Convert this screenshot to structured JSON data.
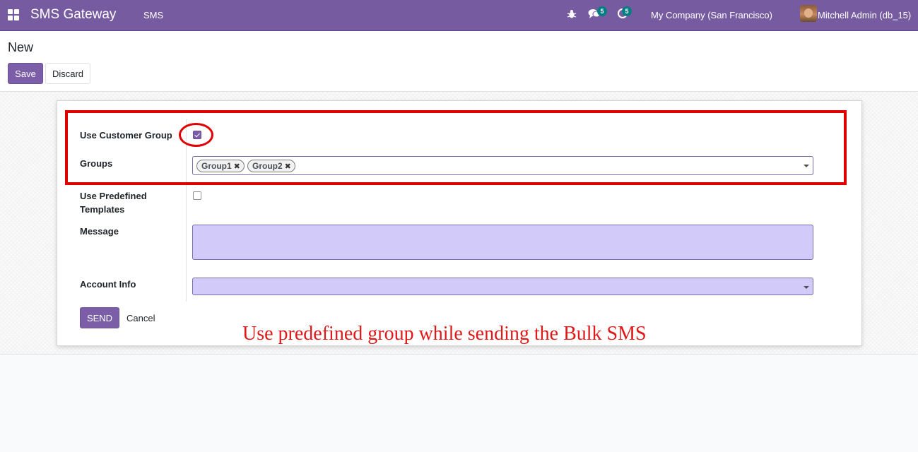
{
  "navbar": {
    "app_title": "SMS Gateway",
    "menu_item": "SMS",
    "chat_badge": "5",
    "activity_badge": "5",
    "company": "My Company (San Francisco)",
    "user": "Mitchell Admin (db_15)",
    "icons": [
      "apps-icon",
      "bug-icon",
      "chat-icon",
      "clock-icon",
      "avatar"
    ],
    "color": "#765ba0"
  },
  "control_panel": {
    "breadcrumb": "New",
    "save_label": "Save",
    "discard_label": "Discard"
  },
  "form": {
    "use_customer_group_label": "Use Customer Group",
    "use_customer_group_checked": true,
    "groups_label": "Groups",
    "groups_tags": [
      "Group1",
      "Group2"
    ],
    "tag_remove_glyph": "✖",
    "use_predefined_label": "Use Predefined Templates",
    "use_predefined_checked": false,
    "message_label": "Message",
    "message_value": "",
    "account_info_label": "Account Info",
    "account_info_value": "",
    "send_label": "SEND",
    "cancel_label": "Cancel"
  },
  "annotation": {
    "text": "Use predefined group while sending the Bulk SMS",
    "color": "#e01818"
  }
}
